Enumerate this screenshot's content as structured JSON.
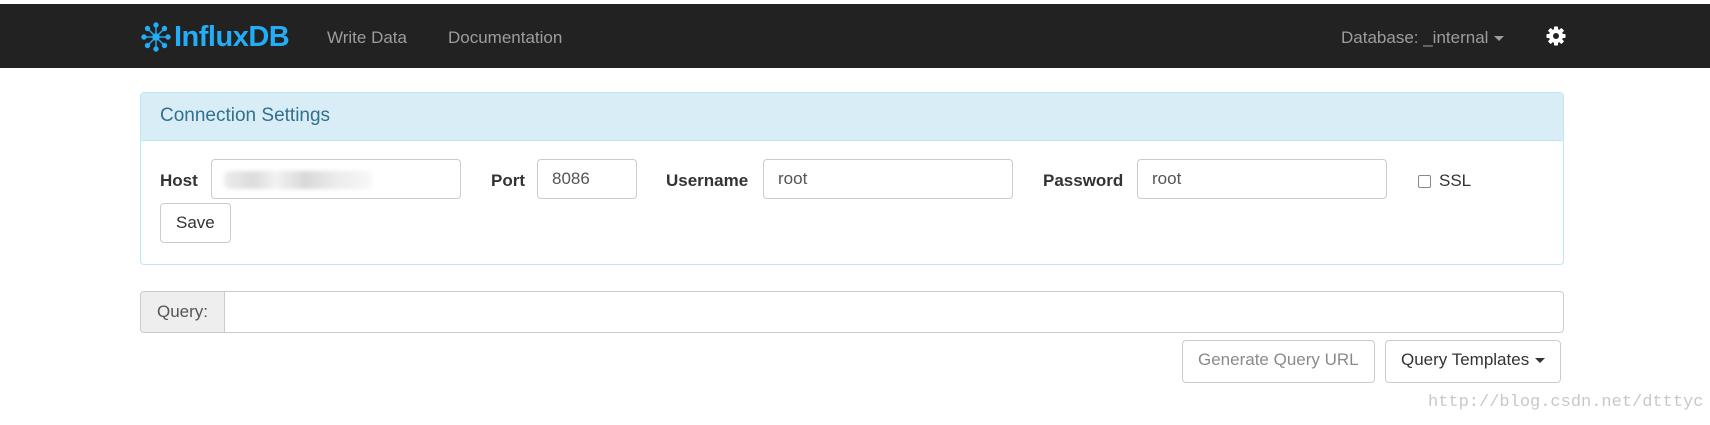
{
  "navbar": {
    "brand_influx": "Influx",
    "brand_db": "DB",
    "links": [
      "Write Data",
      "Documentation"
    ],
    "database_label": "Database: _internal"
  },
  "connection": {
    "heading": "Connection Settings",
    "host_label": "Host",
    "port_label": "Port",
    "port_value": "8086",
    "username_label": "Username",
    "username_value": "root",
    "password_label": "Password",
    "password_value": "root",
    "ssl_label": "SSL",
    "ssl_checked": false,
    "save_label": "Save"
  },
  "query": {
    "addon_label": "Query:",
    "value": "",
    "generate_label": "Generate Query URL",
    "templates_label": "Query Templates"
  },
  "watermark": "http://blog.csdn.net/dtttyc",
  "colors": {
    "navbar_bg": "#222222",
    "brand": "#22ADF6",
    "panel_heading_bg": "#d9edf7",
    "panel_heading_text": "#31708f"
  }
}
